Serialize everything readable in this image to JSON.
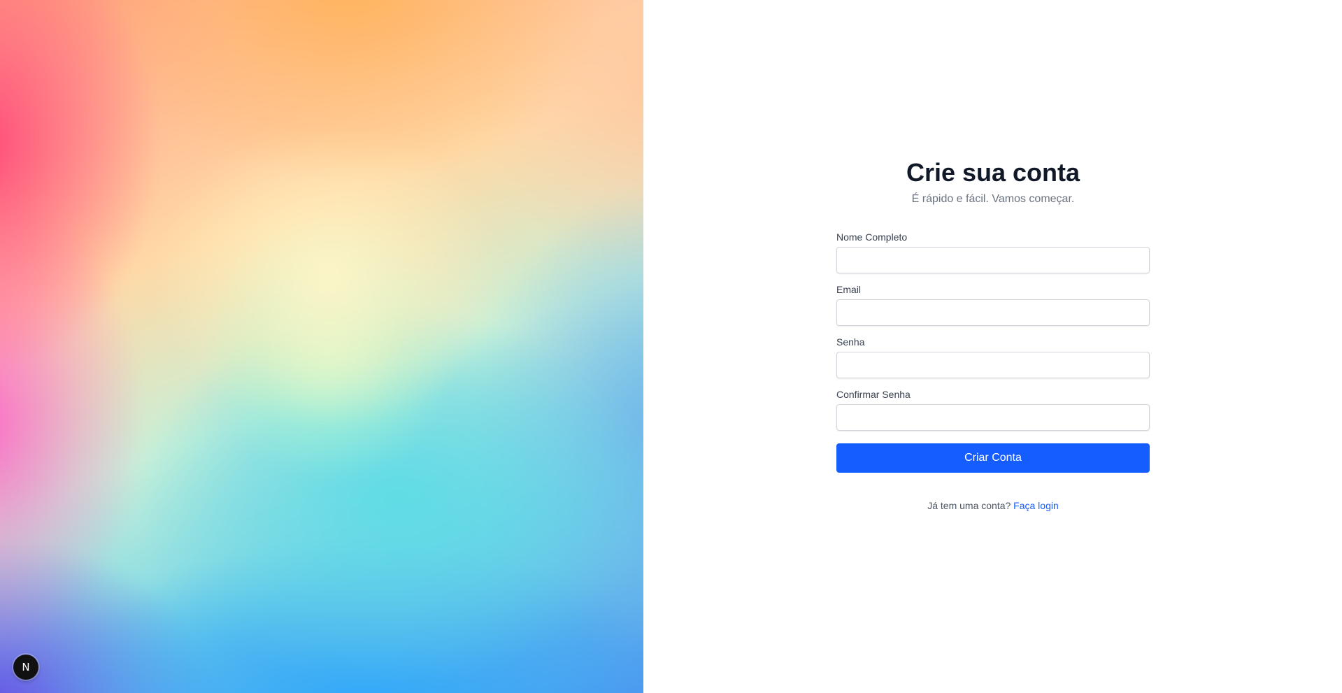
{
  "hero": {
    "badge_letter": "N",
    "badge_icon": "nextjs-logo-icon"
  },
  "signup": {
    "title": "Crie sua conta",
    "subtitle": "É rápido e fácil. Vamos começar.",
    "fields": [
      {
        "label": "Nome Completo",
        "value": "",
        "placeholder": ""
      },
      {
        "label": "Email",
        "value": "",
        "placeholder": ""
      },
      {
        "label": "Senha",
        "value": "",
        "placeholder": ""
      },
      {
        "label": "Confirmar Senha",
        "value": "",
        "placeholder": ""
      }
    ],
    "submit_label": "Criar Conta",
    "login_prompt": "Já tem uma conta?",
    "login_link": "Faça login"
  },
  "colors": {
    "primary": "#165dff",
    "title": "#111827",
    "subtitle": "#6b7280",
    "label": "#374151"
  }
}
